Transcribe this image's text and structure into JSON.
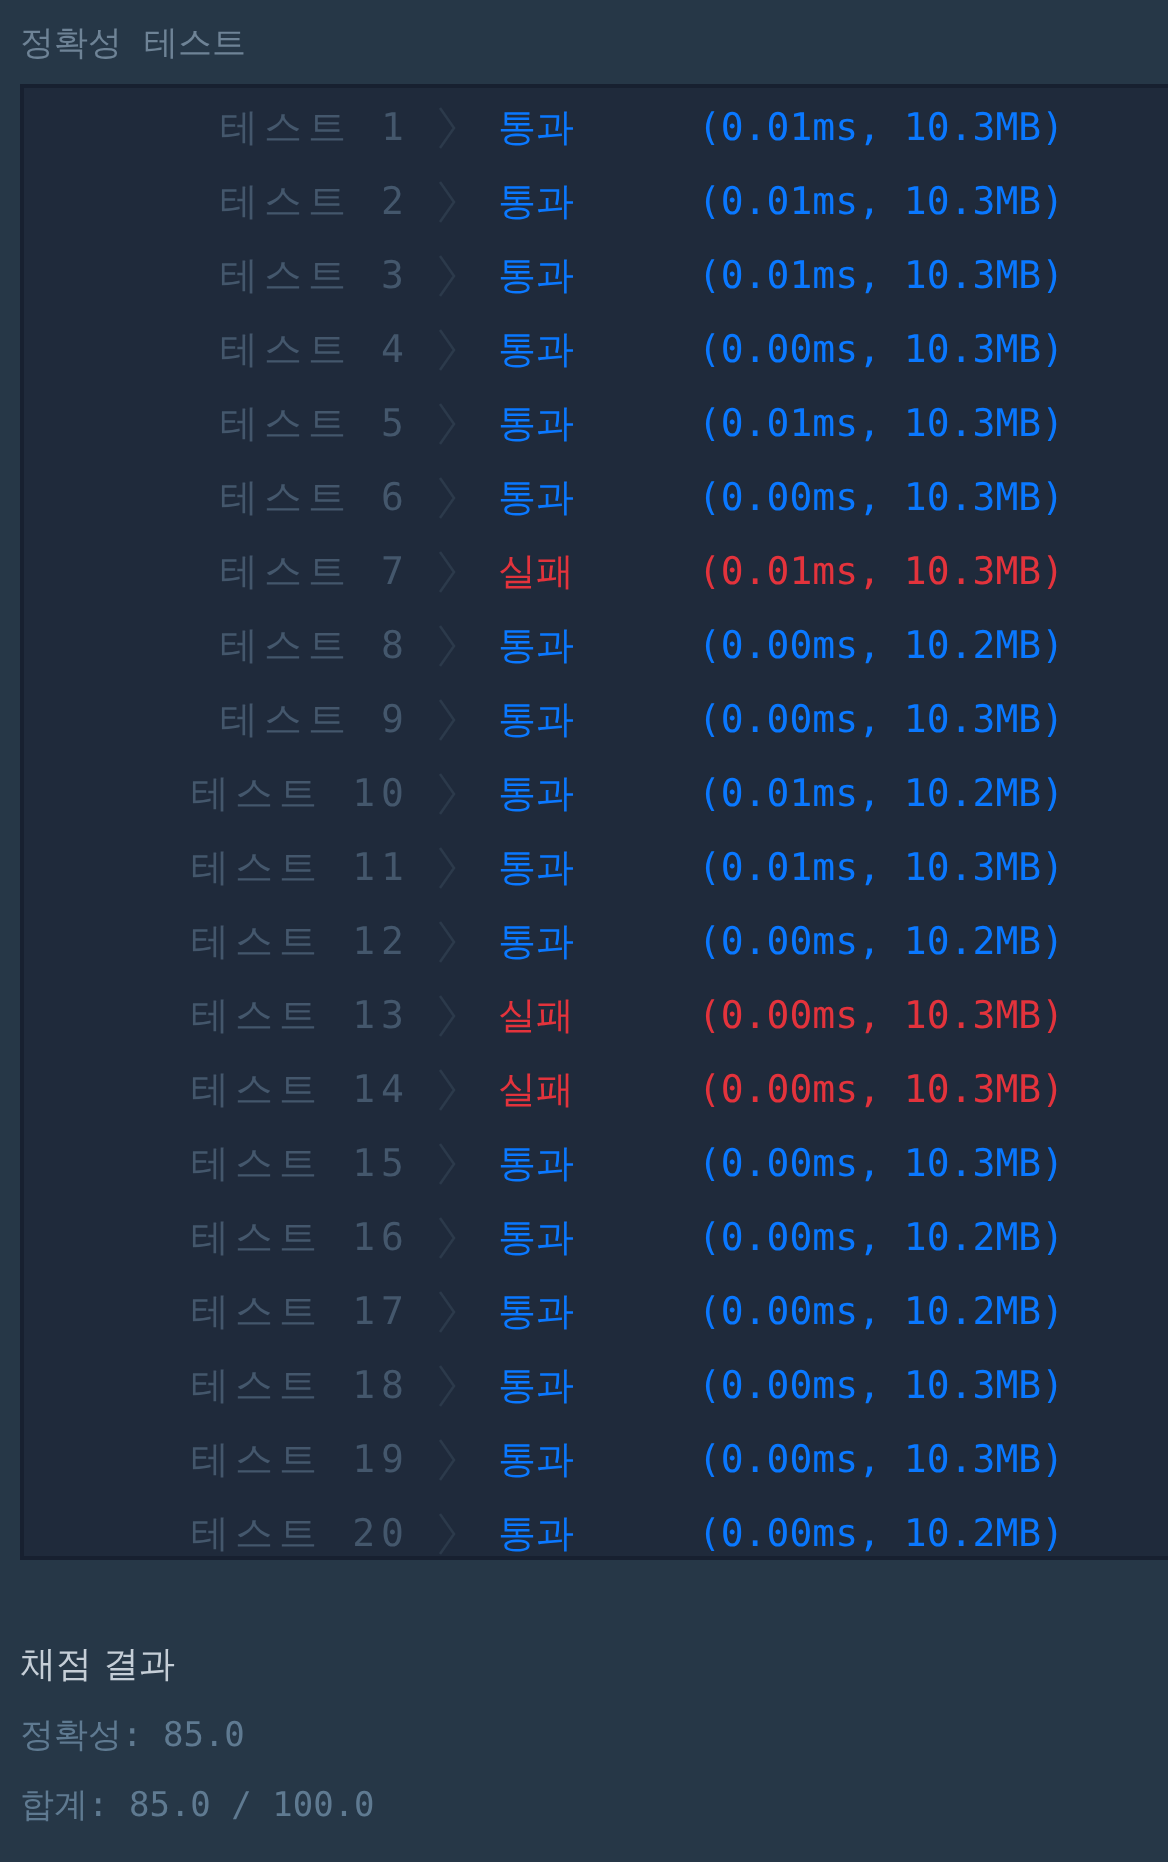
{
  "heading": "정확성  테스트",
  "rows": [
    {
      "label": "테스트 1",
      "passed": true,
      "status": "통과",
      "detail": "(0.01ms, 10.3MB)"
    },
    {
      "label": "테스트 2",
      "passed": true,
      "status": "통과",
      "detail": "(0.01ms, 10.3MB)"
    },
    {
      "label": "테스트 3",
      "passed": true,
      "status": "통과",
      "detail": "(0.01ms, 10.3MB)"
    },
    {
      "label": "테스트 4",
      "passed": true,
      "status": "통과",
      "detail": "(0.00ms, 10.3MB)"
    },
    {
      "label": "테스트 5",
      "passed": true,
      "status": "통과",
      "detail": "(0.01ms, 10.3MB)"
    },
    {
      "label": "테스트 6",
      "passed": true,
      "status": "통과",
      "detail": "(0.00ms, 10.3MB)"
    },
    {
      "label": "테스트 7",
      "passed": false,
      "status": "실패",
      "detail": "(0.01ms, 10.3MB)"
    },
    {
      "label": "테스트 8",
      "passed": true,
      "status": "통과",
      "detail": "(0.00ms, 10.2MB)"
    },
    {
      "label": "테스트 9",
      "passed": true,
      "status": "통과",
      "detail": "(0.00ms, 10.3MB)"
    },
    {
      "label": "테스트 10",
      "passed": true,
      "status": "통과",
      "detail": "(0.01ms, 10.2MB)"
    },
    {
      "label": "테스트 11",
      "passed": true,
      "status": "통과",
      "detail": "(0.01ms, 10.3MB)"
    },
    {
      "label": "테스트 12",
      "passed": true,
      "status": "통과",
      "detail": "(0.00ms, 10.2MB)"
    },
    {
      "label": "테스트 13",
      "passed": false,
      "status": "실패",
      "detail": "(0.00ms, 10.3MB)"
    },
    {
      "label": "테스트 14",
      "passed": false,
      "status": "실패",
      "detail": "(0.00ms, 10.3MB)"
    },
    {
      "label": "테스트 15",
      "passed": true,
      "status": "통과",
      "detail": "(0.00ms, 10.3MB)"
    },
    {
      "label": "테스트 16",
      "passed": true,
      "status": "통과",
      "detail": "(0.00ms, 10.2MB)"
    },
    {
      "label": "테스트 17",
      "passed": true,
      "status": "통과",
      "detail": "(0.00ms, 10.2MB)"
    },
    {
      "label": "테스트 18",
      "passed": true,
      "status": "통과",
      "detail": "(0.00ms, 10.3MB)"
    },
    {
      "label": "테스트 19",
      "passed": true,
      "status": "통과",
      "detail": "(0.00ms, 10.3MB)"
    },
    {
      "label": "테스트 20",
      "passed": true,
      "status": "통과",
      "detail": "(0.00ms, 10.2MB)"
    }
  ],
  "summary": {
    "title": "채점 결과",
    "lines": [
      "정확성: 85.0",
      "합계: 85.0 / 100.0"
    ]
  }
}
